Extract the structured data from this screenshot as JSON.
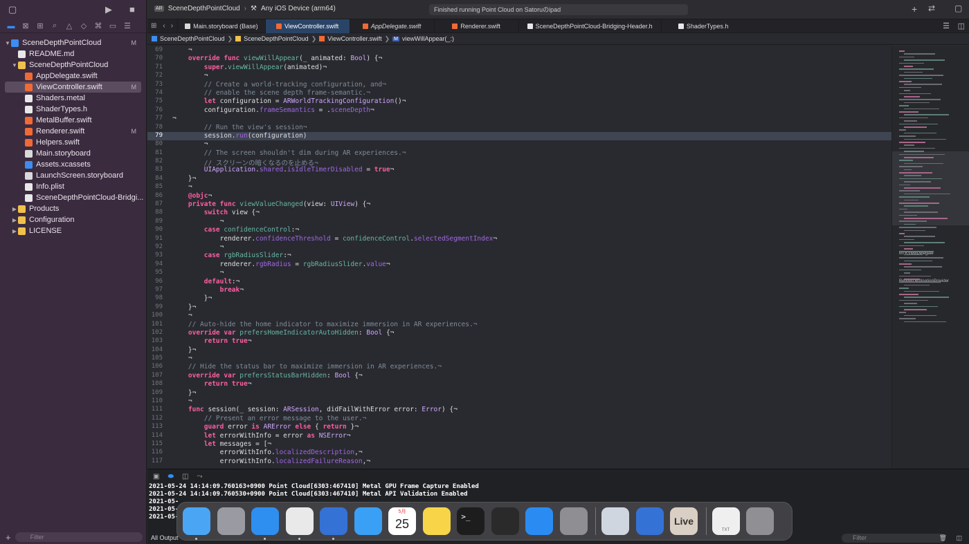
{
  "project": "SceneDepthPointCloud",
  "navigator": {
    "filter_placeholder": "Filter",
    "items": [
      {
        "label": "SceneDepthPointCloud",
        "marker": "M"
      },
      {
        "label": "README.md",
        "marker": ""
      },
      {
        "label": "SceneDepthPointCloud",
        "marker": ""
      },
      {
        "label": "AppDelegate.swift",
        "marker": ""
      },
      {
        "label": "ViewController.swift",
        "marker": "M"
      },
      {
        "label": "Shaders.metal",
        "marker": ""
      },
      {
        "label": "ShaderTypes.h",
        "marker": ""
      },
      {
        "label": "MetalBuffer.swift",
        "marker": ""
      },
      {
        "label": "Renderer.swift",
        "marker": "M"
      },
      {
        "label": "Helpers.swift",
        "marker": ""
      },
      {
        "label": "Main.storyboard",
        "marker": ""
      },
      {
        "label": "Assets.xcassets",
        "marker": ""
      },
      {
        "label": "LaunchScreen.storyboard",
        "marker": ""
      },
      {
        "label": "Info.plist",
        "marker": ""
      },
      {
        "label": "SceneDepthPointCloud-Bridgi...",
        "marker": ""
      },
      {
        "label": "Products",
        "marker": ""
      },
      {
        "label": "Configuration",
        "marker": ""
      },
      {
        "label": "LICENSE",
        "marker": ""
      }
    ]
  },
  "toolbar": {
    "scheme": "SceneDepthPointCloud",
    "scheme_badge": "AR",
    "destination": "Any iOS Device (arm64)",
    "status": "Finished running Point Cloud on Satoruのipad"
  },
  "tabs": [
    "Main.storyboard (Base)",
    "ViewController.swift",
    "AppDelegate.swift",
    "Renderer.swift",
    "SceneDepthPointCloud-Bridging-Header.h",
    "ShaderTypes.h"
  ],
  "breadcrumbs": [
    "SceneDepthPointCloud",
    "SceneDepthPointCloud",
    "ViewController.swift",
    "viewWillAppear(_:)"
  ],
  "breadcrumb_badge": "M",
  "code_lines": [
    {
      "n": "69",
      "t": "    ¬"
    },
    {
      "n": "70",
      "t": "    override func viewWillAppear(_ animated: Bool) {¬"
    },
    {
      "n": "71",
      "t": "        super.viewWillAppear(animated)¬"
    },
    {
      "n": "72",
      "t": "        ¬"
    },
    {
      "n": "73",
      "t": "        // Create a world-tracking configuration, and¬"
    },
    {
      "n": "74",
      "t": "        // enable the scene depth frame-semantic.¬"
    },
    {
      "n": "75",
      "t": "        let configuration = ARWorldTrackingConfiguration()¬"
    },
    {
      "n": "76",
      "t": "        configuration.frameSemantics = .sceneDepth¬"
    },
    {
      "n": "77",
      "t": "¬"
    },
    {
      "n": "78",
      "t": "        // Run the view's session¬"
    },
    {
      "n": "79",
      "t": "        session.run(configuration)"
    },
    {
      "n": "80",
      "t": "        ¬"
    },
    {
      "n": "81",
      "t": "        // The screen shouldn't dim during AR experiences.¬"
    },
    {
      "n": "82",
      "t": "        // スクリーンの暗くなるのを止める¬"
    },
    {
      "n": "83",
      "t": "        UIApplication.shared.isIdleTimerDisabled = true¬"
    },
    {
      "n": "84",
      "t": "    }¬"
    },
    {
      "n": "85",
      "t": "    ¬"
    },
    {
      "n": "86",
      "t": "    @objc¬"
    },
    {
      "n": "87",
      "t": "    private func viewValueChanged(view: UIView) {¬"
    },
    {
      "n": "88",
      "t": "        switch view {¬"
    },
    {
      "n": "89",
      "t": "            ¬"
    },
    {
      "n": "90",
      "t": "        case confidenceControl:¬"
    },
    {
      "n": "91",
      "t": "            renderer.confidenceThreshold = confidenceControl.selectedSegmentIndex¬"
    },
    {
      "n": "92",
      "t": "            ¬"
    },
    {
      "n": "93",
      "t": "        case rgbRadiusSlider:¬"
    },
    {
      "n": "94",
      "t": "            renderer.rgbRadius = rgbRadiusSlider.value¬"
    },
    {
      "n": "95",
      "t": "            ¬"
    },
    {
      "n": "96",
      "t": "        default:¬"
    },
    {
      "n": "97",
      "t": "            break¬"
    },
    {
      "n": "98",
      "t": "        }¬"
    },
    {
      "n": "99",
      "t": "    }¬"
    },
    {
      "n": "100",
      "t": "    ¬"
    },
    {
      "n": "101",
      "t": "    // Auto-hide the home indicator to maximize immersion in AR experiences.¬"
    },
    {
      "n": "102",
      "t": "    override var prefersHomeIndicatorAutoHidden: Bool {¬"
    },
    {
      "n": "103",
      "t": "        return true¬"
    },
    {
      "n": "104",
      "t": "    }¬"
    },
    {
      "n": "105",
      "t": "    ¬"
    },
    {
      "n": "106",
      "t": "    // Hide the status bar to maximize immersion in AR experiences.¬"
    },
    {
      "n": "107",
      "t": "    override var prefersStatusBarHidden: Bool {¬"
    },
    {
      "n": "108",
      "t": "        return true¬"
    },
    {
      "n": "109",
      "t": "    }¬"
    },
    {
      "n": "110",
      "t": "    ¬"
    },
    {
      "n": "111",
      "t": "    func session(_ session: ARSession, didFailWithError error: Error) {¬"
    },
    {
      "n": "112",
      "t": "        // Present an error message to the user.¬"
    },
    {
      "n": "113",
      "t": "        guard error is ARError else { return }¬"
    },
    {
      "n": "114",
      "t": "        let errorWithInfo = error as NSError¬"
    },
    {
      "n": "115",
      "t": "        let messages = [¬"
    },
    {
      "n": "116",
      "t": "            errorWithInfo.localizedDescription,¬"
    },
    {
      "n": "117",
      "t": "            errorWithInfo.localizedFailureReason,¬"
    }
  ],
  "minimap_labels": [
    "MTKViewDelegate",
    "RenderDestinationProvider"
  ],
  "console": {
    "lines": [
      "2021-05-24 14:14:09.760163+0900 Point Cloud[6303:467410] Metal GPU Frame Capture Enabled",
      "2021-05-24 14:14:09.760530+0900 Point Cloud[6303:467410] Metal API Validation Enabled",
      "2021-05-",
      "2021-05-",
      "2021-05-"
    ],
    "output_selector": "All Output",
    "filter_placeholder": "Filter"
  },
  "dock": [
    {
      "name": "finder",
      "bg": "#4aa6f5",
      "label": ""
    },
    {
      "name": "launchpad",
      "bg": "#9a9aa2",
      "label": ""
    },
    {
      "name": "safari",
      "bg": "#2e8ff0",
      "label": ""
    },
    {
      "name": "chrome",
      "bg": "#e9e9e9",
      "label": ""
    },
    {
      "name": "xcode",
      "bg": "#3572d6",
      "label": ""
    },
    {
      "name": "mail",
      "bg": "#3aa0f5",
      "label": ""
    },
    {
      "name": "calendar",
      "bg": "#ffffff",
      "label": "25",
      "sub": "5月"
    },
    {
      "name": "notes",
      "bg": "#f8d548",
      "label": ""
    },
    {
      "name": "terminal",
      "bg": "#1d1d1d",
      "label": ">_"
    },
    {
      "name": "activity-monitor",
      "bg": "#2a2a2a",
      "label": ""
    },
    {
      "name": "app-store",
      "bg": "#2a8cf3",
      "label": ""
    },
    {
      "name": "system-preferences",
      "bg": "#8e8e93",
      "label": ""
    },
    {
      "name": "preview",
      "bg": "#cfd6e0",
      "label": ""
    },
    {
      "name": "xcode-2",
      "bg": "#3572d6",
      "label": ""
    },
    {
      "name": "live",
      "bg": "#d9cfc4",
      "label": "Live"
    },
    {
      "name": "txt-file",
      "bg": "#efefef",
      "label": "TXT"
    },
    {
      "name": "trash",
      "bg": "#8f8f94",
      "label": ""
    }
  ]
}
